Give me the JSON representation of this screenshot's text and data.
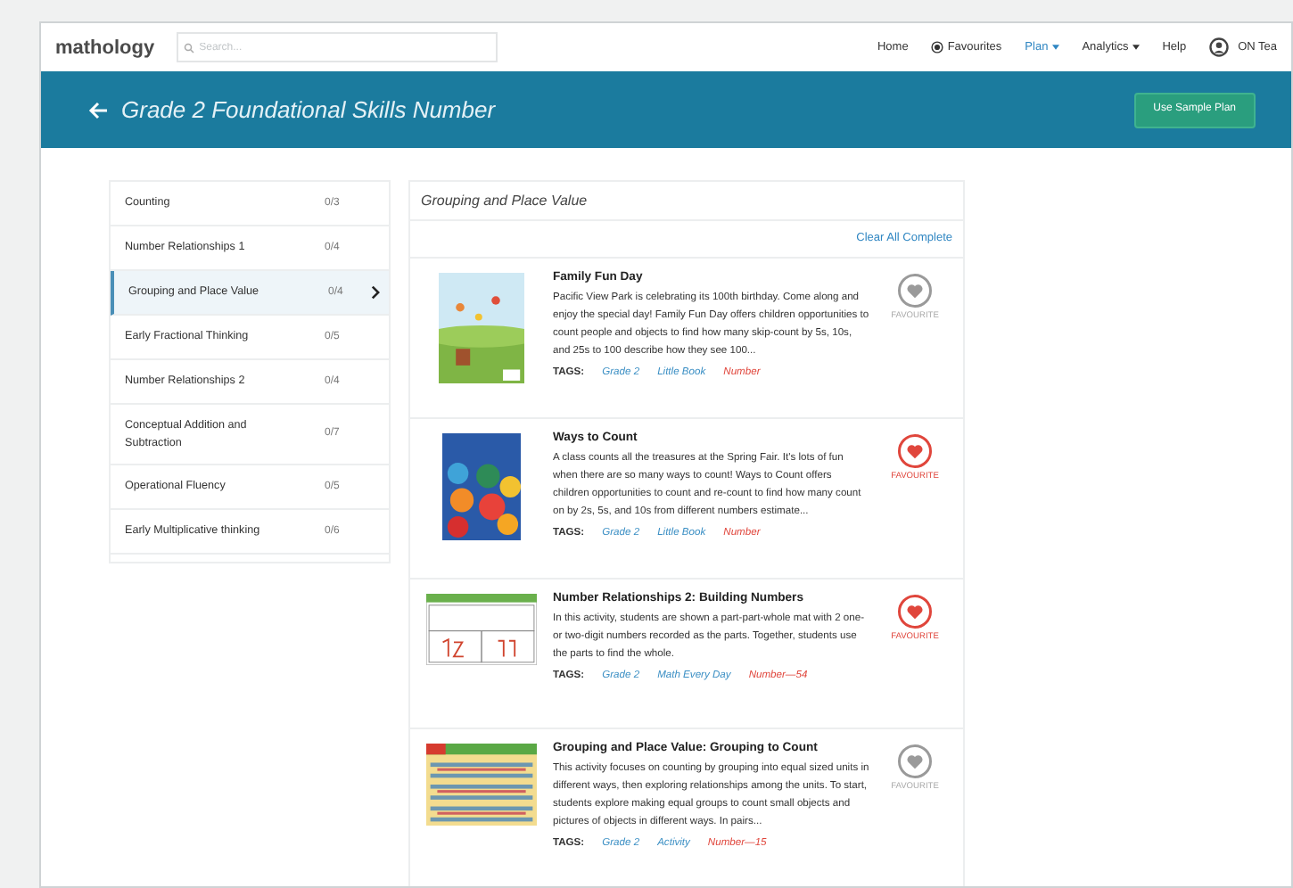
{
  "nav": {
    "logo": "mathology",
    "search": {
      "placeholder": "Search..."
    },
    "links": [
      {
        "label": "Home",
        "kind": "plain",
        "selected": false
      },
      {
        "label": "Favourites",
        "kind": "favourites",
        "selected": false
      },
      {
        "label": "Plan",
        "kind": "menu",
        "selected": true
      },
      {
        "label": "Analytics",
        "kind": "menu",
        "selected": false
      },
      {
        "label": "Help",
        "kind": "plain",
        "selected": false
      }
    ],
    "user": "ON Tea"
  },
  "banner": {
    "title": "Grade 2 Foundational Skills Number",
    "button": "Use Sample Plan"
  },
  "sidebar": {
    "items": [
      {
        "label": "Counting",
        "count": "0/3",
        "selected": false
      },
      {
        "label": "Number Relationships 1",
        "count": "0/4",
        "selected": false
      },
      {
        "label": "Grouping and Place Value",
        "count": "0/4",
        "selected": true
      },
      {
        "label": "Early Fractional Thinking",
        "count": "0/5",
        "selected": false
      },
      {
        "label": "Number Relationships 2",
        "count": "0/4",
        "selected": false
      },
      {
        "label": "Conceptual Addition and Subtraction",
        "count": "0/7",
        "selected": false
      },
      {
        "label": "Operational Fluency",
        "count": "0/5",
        "selected": false
      },
      {
        "label": "Early Multiplicative thinking",
        "count": "0/6",
        "selected": false
      }
    ]
  },
  "main": {
    "heading": "Grouping and Place Value",
    "clear": "Clear All Complete",
    "items": [
      {
        "title": "Family Fun Day",
        "description": "Pacific View Park is celebrating its 100th birthday. Come along and enjoy the special day! Family Fun Day offers children opportunities to count people and objects to find how many skip-count by 5s, 10s, and 25s to 100 describe how they see 100...",
        "favourite": false,
        "favourite_label": "FAVOURITE",
        "tags_label": "TAGS:",
        "tags": [
          {
            "label": "Grade 2",
            "color": "#3b8fc4"
          },
          {
            "label": "Little Book",
            "color": "#3b8fc4"
          },
          {
            "label": "Number",
            "color": "#e0463c"
          }
        ]
      },
      {
        "title": "Ways to Count",
        "description": "A class counts all the treasures at the Spring Fair. It's lots of fun when there are so many ways to count! Ways to Count offers children opportunities to count and re-count to find how many count on by 2s, 5s, and 10s from different numbers estimate...",
        "favourite": true,
        "favourite_label": "FAVOURITE",
        "tags_label": "TAGS:",
        "tags": [
          {
            "label": "Grade 2",
            "color": "#3b8fc4"
          },
          {
            "label": "Little Book",
            "color": "#3b8fc4"
          },
          {
            "label": "Number",
            "color": "#e0463c"
          }
        ]
      },
      {
        "title": "Number Relationships 2: Building Numbers",
        "description": "In this activity, students are shown a part-part-whole mat with 2 one- or two-digit numbers recorded as the parts. Together, students use the parts to find the whole.",
        "favourite": true,
        "favourite_label": "FAVOURITE",
        "tags_label": "TAGS:",
        "tags": [
          {
            "label": "Grade 2",
            "color": "#3b8fc4"
          },
          {
            "label": "Math Every Day",
            "color": "#3b8fc4"
          },
          {
            "label": "Number—54",
            "color": "#e0463c"
          }
        ]
      },
      {
        "title": "Grouping and Place Value: Grouping to Count",
        "description": "This activity focuses on counting by grouping into equal sized units in different ways, then exploring relationships among the units. To start, students explore making equal groups to count small objects and pictures of objects in different ways. In pairs...",
        "favourite": false,
        "favourite_label": "FAVOURITE",
        "tags_label": "TAGS:",
        "tags": [
          {
            "label": "Grade 2",
            "color": "#3b8fc4"
          },
          {
            "label": "Activity",
            "color": "#3b8fc4"
          },
          {
            "label": "Number—15",
            "color": "#e0463c"
          }
        ]
      }
    ]
  }
}
